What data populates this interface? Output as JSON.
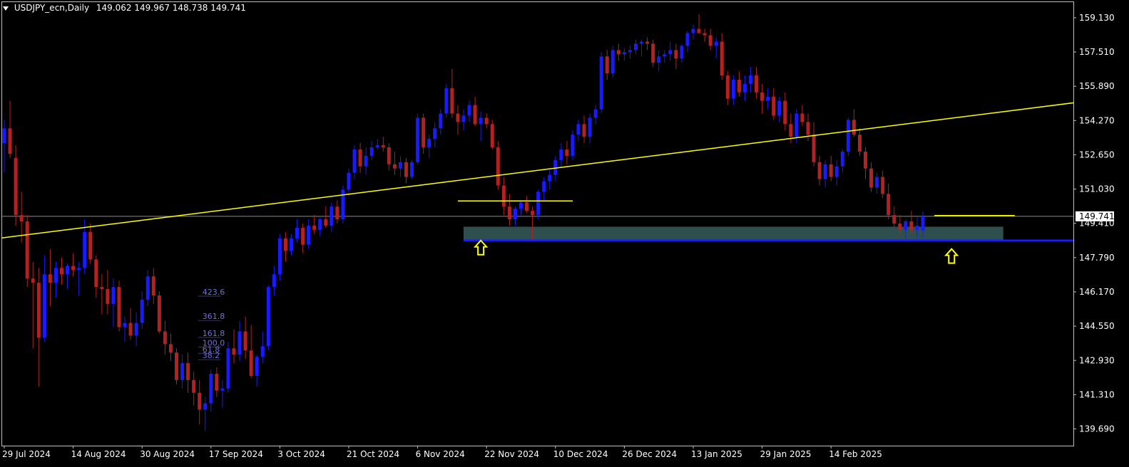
{
  "header": {
    "symbol_label": "USDJPY_ecn,Daily",
    "ohlc_label": "149.062 149.967 148.738 149.741"
  },
  "colors": {
    "background": "#000000",
    "bull": "#1a1aff",
    "bear": "#b22222",
    "trendline": "#ffff00",
    "support_line": "#1a1aff",
    "zone": "#2f4f4f",
    "grid_frame": "#c0c0c0",
    "current_price_line": "#8c8c8c",
    "fib_labels": "#6f6fd8"
  },
  "chart_data": {
    "type": "candlestick",
    "symbol": "USDJPY_ecn",
    "timeframe": "Daily",
    "y_axis": {
      "ticks": [
        "159.130",
        "157.510",
        "155.890",
        "154.270",
        "152.650",
        "151.030",
        "149.410",
        "147.790",
        "146.170",
        "144.550",
        "142.930",
        "141.310",
        "139.690"
      ],
      "range": [
        138.9,
        159.9
      ]
    },
    "x_axis": {
      "ticks": [
        "29 Jul 2024",
        "14 Aug 2024",
        "30 Aug 2024",
        "17 Sep 2024",
        "3 Oct 2024",
        "21 Oct 2024",
        "6 Nov 2024",
        "22 Nov 2024",
        "10 Dec 2024",
        "26 Dec 2024",
        "13 Jan 2025",
        "29 Jan 2025",
        "14 Feb 2025"
      ],
      "tick_bar_index": [
        0,
        12,
        24,
        36,
        48,
        60,
        72,
        84,
        96,
        108,
        120,
        132,
        144
      ]
    },
    "current_price": "149.741",
    "ohlc": [
      [
        153.2,
        154.3,
        151.8,
        153.9
      ],
      [
        153.9,
        155.2,
        152.5,
        152.7
      ],
      [
        152.5,
        153.1,
        149.3,
        149.8
      ],
      [
        149.8,
        150.9,
        148.5,
        149.5
      ],
      [
        149.5,
        149.8,
        146.4,
        146.8
      ],
      [
        146.8,
        147.6,
        143.5,
        146.6
      ],
      [
        146.6,
        147.3,
        141.7,
        144.0
      ],
      [
        144.0,
        147.9,
        143.8,
        147.0
      ],
      [
        147.0,
        148.2,
        145.5,
        146.6
      ],
      [
        146.6,
        147.6,
        145.9,
        147.3
      ],
      [
        147.3,
        147.8,
        146.5,
        147.0
      ],
      [
        147.0,
        147.5,
        146.3,
        147.4
      ],
      [
        147.4,
        148.0,
        146.9,
        147.2
      ],
      [
        147.2,
        147.6,
        146.0,
        147.3
      ],
      [
        147.3,
        149.6,
        147.0,
        149.0
      ],
      [
        149.0,
        149.4,
        147.5,
        147.7
      ],
      [
        147.7,
        147.9,
        145.9,
        146.4
      ],
      [
        146.4,
        147.0,
        145.1,
        146.3
      ],
      [
        146.3,
        147.2,
        145.1,
        145.6
      ],
      [
        145.6,
        146.8,
        144.5,
        146.4
      ],
      [
        146.4,
        146.7,
        144.3,
        144.5
      ],
      [
        144.5,
        145.0,
        143.8,
        144.7
      ],
      [
        144.7,
        145.4,
        143.9,
        144.1
      ],
      [
        144.1,
        145.2,
        143.6,
        144.7
      ],
      [
        144.7,
        146.2,
        144.4,
        145.8
      ],
      [
        145.8,
        147.2,
        145.5,
        146.9
      ],
      [
        146.9,
        147.3,
        145.6,
        146.0
      ],
      [
        146.0,
        146.2,
        144.2,
        144.3
      ],
      [
        144.3,
        144.8,
        143.2,
        143.7
      ],
      [
        143.7,
        144.2,
        142.9,
        143.3
      ],
      [
        143.3,
        143.5,
        141.8,
        142.0
      ],
      [
        142.0,
        143.2,
        141.6,
        142.8
      ],
      [
        142.8,
        143.3,
        141.4,
        142.0
      ],
      [
        142.0,
        142.4,
        140.8,
        141.4
      ],
      [
        141.4,
        142.0,
        139.9,
        140.6
      ],
      [
        140.6,
        141.2,
        139.6,
        140.9
      ],
      [
        140.9,
        142.5,
        140.5,
        142.3
      ],
      [
        142.3,
        142.6,
        141.2,
        141.5
      ],
      [
        141.5,
        142.0,
        140.7,
        141.6
      ],
      [
        141.6,
        143.8,
        141.4,
        143.5
      ],
      [
        143.5,
        144.4,
        142.8,
        143.2
      ],
      [
        143.2,
        144.8,
        142.9,
        144.3
      ],
      [
        144.3,
        145.0,
        143.0,
        143.4
      ],
      [
        143.4,
        144.6,
        142.1,
        142.2
      ],
      [
        142.2,
        143.2,
        141.7,
        143.1
      ],
      [
        143.1,
        144.3,
        142.8,
        143.6
      ],
      [
        143.6,
        146.5,
        143.4,
        146.4
      ],
      [
        146.4,
        147.4,
        146.0,
        147.0
      ],
      [
        147.0,
        148.9,
        146.7,
        148.7
      ],
      [
        148.7,
        149.0,
        147.6,
        148.1
      ],
      [
        148.1,
        148.9,
        147.9,
        148.7
      ],
      [
        148.7,
        149.6,
        148.5,
        149.2
      ],
      [
        149.2,
        149.4,
        148.0,
        148.4
      ],
      [
        148.4,
        149.6,
        148.2,
        149.3
      ],
      [
        149.3,
        149.8,
        148.9,
        149.1
      ],
      [
        149.1,
        149.7,
        148.8,
        149.6
      ],
      [
        149.6,
        150.2,
        149.2,
        149.3
      ],
      [
        149.3,
        150.4,
        149.0,
        150.2
      ],
      [
        150.2,
        150.5,
        149.4,
        149.6
      ],
      [
        149.6,
        151.2,
        149.4,
        151.0
      ],
      [
        151.0,
        152.0,
        150.7,
        151.8
      ],
      [
        151.8,
        153.1,
        151.5,
        152.9
      ],
      [
        152.9,
        153.2,
        151.8,
        152.1
      ],
      [
        152.1,
        153.0,
        151.7,
        152.6
      ],
      [
        152.6,
        153.3,
        152.4,
        153.0
      ],
      [
        153.0,
        153.4,
        152.9,
        153.1
      ],
      [
        153.1,
        153.5,
        152.8,
        153.0
      ],
      [
        153.0,
        153.2,
        151.9,
        152.2
      ],
      [
        152.2,
        152.8,
        151.7,
        152.0
      ],
      [
        152.0,
        152.6,
        151.6,
        152.3
      ],
      [
        152.3,
        152.5,
        151.3,
        151.6
      ],
      [
        151.6,
        152.4,
        151.5,
        152.3
      ],
      [
        152.3,
        154.6,
        152.2,
        154.4
      ],
      [
        154.4,
        154.6,
        152.7,
        153.0
      ],
      [
        153.0,
        153.6,
        152.5,
        153.4
      ],
      [
        153.4,
        154.2,
        153.0,
        153.9
      ],
      [
        153.9,
        154.8,
        153.6,
        154.6
      ],
      [
        154.6,
        156.0,
        154.4,
        155.8
      ],
      [
        155.8,
        156.7,
        154.4,
        154.6
      ],
      [
        154.6,
        155.0,
        153.6,
        154.2
      ],
      [
        154.2,
        154.8,
        153.8,
        154.5
      ],
      [
        154.5,
        155.2,
        154.2,
        155.0
      ],
      [
        155.0,
        155.4,
        154.0,
        154.1
      ],
      [
        154.1,
        154.7,
        153.3,
        154.4
      ],
      [
        154.4,
        154.6,
        153.9,
        154.1
      ],
      [
        154.1,
        154.3,
        152.9,
        153.0
      ],
      [
        153.0,
        153.3,
        151.0,
        151.2
      ],
      [
        151.2,
        151.6,
        149.8,
        150.2
      ],
      [
        150.2,
        150.8,
        149.3,
        149.6
      ],
      [
        149.6,
        150.2,
        149.3,
        150.1
      ],
      [
        150.1,
        150.5,
        149.8,
        150.4
      ],
      [
        150.4,
        150.7,
        149.9,
        150.0
      ],
      [
        150.0,
        150.2,
        148.6,
        149.8
      ],
      [
        149.8,
        151.0,
        149.6,
        150.9
      ],
      [
        150.9,
        151.6,
        150.5,
        151.4
      ],
      [
        151.4,
        152.0,
        151.0,
        151.7
      ],
      [
        151.7,
        152.6,
        151.4,
        152.4
      ],
      [
        152.4,
        153.2,
        152.0,
        152.9
      ],
      [
        152.9,
        153.3,
        152.2,
        152.6
      ],
      [
        152.6,
        153.8,
        152.4,
        153.6
      ],
      [
        153.6,
        154.3,
        153.3,
        154.1
      ],
      [
        154.1,
        154.5,
        153.2,
        153.5
      ],
      [
        153.5,
        154.6,
        153.2,
        154.4
      ],
      [
        154.4,
        155.0,
        154.1,
        154.8
      ],
      [
        154.8,
        157.5,
        154.6,
        157.3
      ],
      [
        157.3,
        157.6,
        156.2,
        156.5
      ],
      [
        156.5,
        157.8,
        156.3,
        157.6
      ],
      [
        157.6,
        157.9,
        157.1,
        157.4
      ],
      [
        157.4,
        157.7,
        157.1,
        157.5
      ],
      [
        157.5,
        157.8,
        157.2,
        157.6
      ],
      [
        157.6,
        158.1,
        157.4,
        157.9
      ],
      [
        157.9,
        158.1,
        157.3,
        158.0
      ],
      [
        158.0,
        158.2,
        157.6,
        157.9
      ],
      [
        157.9,
        158.1,
        156.8,
        157.0
      ],
      [
        157.0,
        157.6,
        156.6,
        157.3
      ],
      [
        157.3,
        157.6,
        157.0,
        157.4
      ],
      [
        157.4,
        158.0,
        157.1,
        157.6
      ],
      [
        157.6,
        157.9,
        156.7,
        157.2
      ],
      [
        157.2,
        157.9,
        157.0,
        157.8
      ],
      [
        157.8,
        158.5,
        157.5,
        158.4
      ],
      [
        158.4,
        158.8,
        158.1,
        158.6
      ],
      [
        158.6,
        159.3,
        158.4,
        158.4
      ],
      [
        158.4,
        158.6,
        158.0,
        158.3
      ],
      [
        158.3,
        158.6,
        157.6,
        157.8
      ],
      [
        157.8,
        158.2,
        157.2,
        158.0
      ],
      [
        158.0,
        158.4,
        156.2,
        156.4
      ],
      [
        156.4,
        156.6,
        155.0,
        155.3
      ],
      [
        155.3,
        156.4,
        155.0,
        156.2
      ],
      [
        156.2,
        156.6,
        155.4,
        155.6
      ],
      [
        155.6,
        156.4,
        155.2,
        156.0
      ],
      [
        156.0,
        156.8,
        155.6,
        156.4
      ],
      [
        156.4,
        156.8,
        155.3,
        155.6
      ],
      [
        155.6,
        156.0,
        154.6,
        155.2
      ],
      [
        155.2,
        155.8,
        154.8,
        155.4
      ],
      [
        155.4,
        155.8,
        154.3,
        154.5
      ],
      [
        154.5,
        155.4,
        154.2,
        155.2
      ],
      [
        155.2,
        155.6,
        153.8,
        154.1
      ],
      [
        154.1,
        154.6,
        153.2,
        153.5
      ],
      [
        153.5,
        154.8,
        153.2,
        154.6
      ],
      [
        154.6,
        155.0,
        154.0,
        154.2
      ],
      [
        154.2,
        154.6,
        153.3,
        153.6
      ],
      [
        153.6,
        154.2,
        152.1,
        152.3
      ],
      [
        152.3,
        152.6,
        151.2,
        151.5
      ],
      [
        151.5,
        152.4,
        151.1,
        152.2
      ],
      [
        152.2,
        152.6,
        151.4,
        151.6
      ],
      [
        151.6,
        152.4,
        151.2,
        152.1
      ],
      [
        152.1,
        152.9,
        151.8,
        152.8
      ],
      [
        152.8,
        154.4,
        152.6,
        154.3
      ],
      [
        154.3,
        154.8,
        153.5,
        153.6
      ],
      [
        153.6,
        153.9,
        152.6,
        152.8
      ],
      [
        152.8,
        153.0,
        151.5,
        152.0
      ],
      [
        152.0,
        152.3,
        150.9,
        151.1
      ],
      [
        151.1,
        151.8,
        150.8,
        151.6
      ],
      [
        151.6,
        151.9,
        150.6,
        150.8
      ],
      [
        150.8,
        151.3,
        149.6,
        149.8
      ],
      [
        149.8,
        150.2,
        149.2,
        149.4
      ],
      [
        149.4,
        149.8,
        148.9,
        149.1
      ],
      [
        149.1,
        149.6,
        148.6,
        149.5
      ],
      [
        149.5,
        150.0,
        148.9,
        149.1
      ],
      [
        149.1,
        149.7,
        148.7,
        149.3
      ],
      [
        149.062,
        149.967,
        148.738,
        149.741
      ]
    ],
    "annotations": {
      "trendline": {
        "bar_from": -1,
        "price_from": 148.7,
        "bar_to": 300,
        "price_to": 159.0
      },
      "support_line": {
        "bar_from": 80,
        "bar_to": 300,
        "price": 148.6
      },
      "zone": {
        "bar_from": 80,
        "bar_to": 174,
        "price_top": 149.25,
        "price_bottom": 148.6
      },
      "resistance_left": {
        "bar_from": 79,
        "bar_to": 99,
        "price": 150.47
      },
      "resistance_right": {
        "bar_from": 162,
        "bar_to": 176,
        "price": 149.78
      },
      "arrows": [
        {
          "bar": 83,
          "price": 148.6
        },
        {
          "bar": 165,
          "price": 148.2
        }
      ],
      "fib_labels": [
        {
          "text": "423.6",
          "bar": 35,
          "price": 146.0
        },
        {
          "text": "361.8",
          "bar": 35,
          "price": 144.85
        },
        {
          "text": "161.8",
          "bar": 35,
          "price": 144.05
        },
        {
          "text": "100.0",
          "bar": 35,
          "price": 143.6
        },
        {
          "text": "61.8",
          "bar": 35,
          "price": 143.3
        },
        {
          "text": "38.2",
          "bar": 35,
          "price": 143.0
        }
      ]
    }
  }
}
